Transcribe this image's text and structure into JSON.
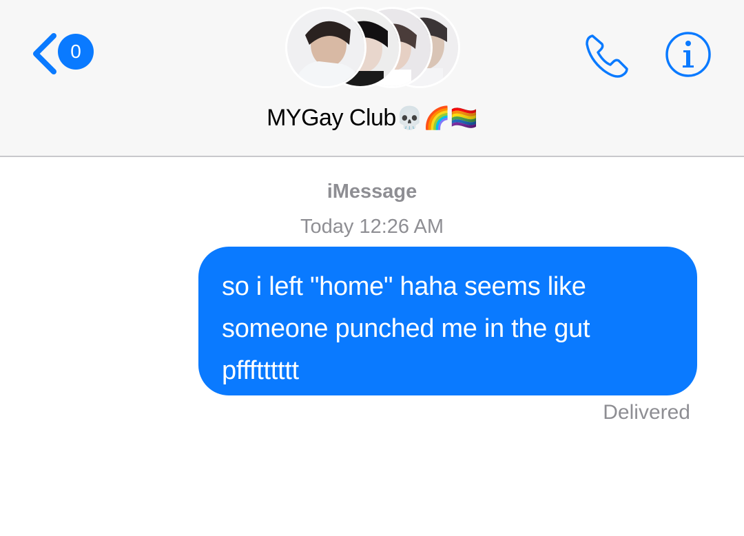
{
  "header": {
    "back_badge_count": "0",
    "group_title": "MYGay Club",
    "title_emojis": "💀🌈🏳️‍🌈",
    "avatars": [
      "avatar-1",
      "avatar-2",
      "avatar-3",
      "avatar-4"
    ],
    "accent_color": "#0a7aff"
  },
  "conversation": {
    "service_label": "iMessage",
    "timestamp": "Today 12:26 AM",
    "messages": [
      {
        "direction": "outgoing",
        "text": "so i left \"home\" haha seems like someone punched me in the gut pffftttttt"
      }
    ],
    "delivery_status": "Delivered"
  },
  "icons": {
    "back": "chevron-left-icon",
    "phone": "phone-icon",
    "info": "info-icon"
  }
}
